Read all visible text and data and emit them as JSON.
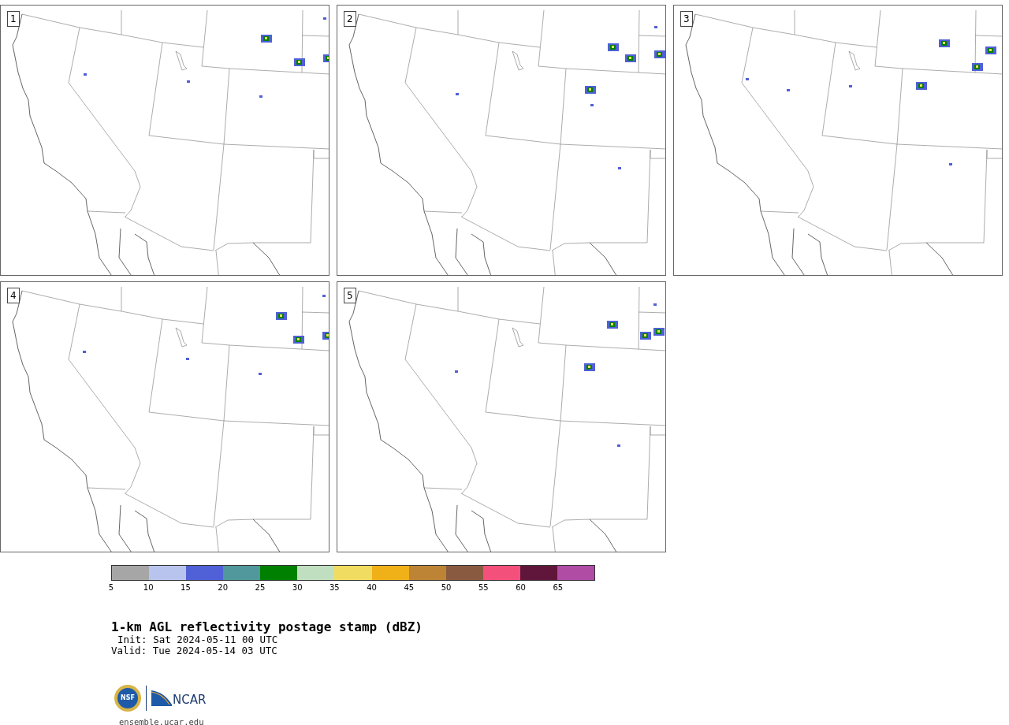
{
  "panels": [
    {
      "label": "1"
    },
    {
      "label": "2"
    },
    {
      "label": "3"
    },
    {
      "label": "4"
    },
    {
      "label": "5"
    }
  ],
  "colorbar": {
    "bins": [
      {
        "color": "#a6a6a6"
      },
      {
        "color": "#b8c3ee"
      },
      {
        "color": "#5060d6"
      },
      {
        "color": "#50989c"
      },
      {
        "color": "#008000"
      },
      {
        "color": "#c0dfc0"
      },
      {
        "color": "#f0dc60"
      },
      {
        "color": "#f0b018"
      },
      {
        "color": "#bc8434"
      },
      {
        "color": "#8a5a40"
      },
      {
        "color": "#f4507c"
      },
      {
        "color": "#60163a"
      },
      {
        "color": "#b04ca4"
      }
    ],
    "ticks": [
      "5",
      "10",
      "15",
      "20",
      "25",
      "30",
      "35",
      "40",
      "45",
      "50",
      "55",
      "60",
      "65"
    ]
  },
  "title": "1-km AGL reflectivity postage stamp (dBZ)",
  "init": "Init: Sat 2024-05-11 00 UTC",
  "valid": "Valid: Tue 2024-05-14 03 UTC",
  "logos": {
    "nsf": "NSF",
    "ncar": "NCAR"
  },
  "footer": "ensemble.ucar.edu"
}
